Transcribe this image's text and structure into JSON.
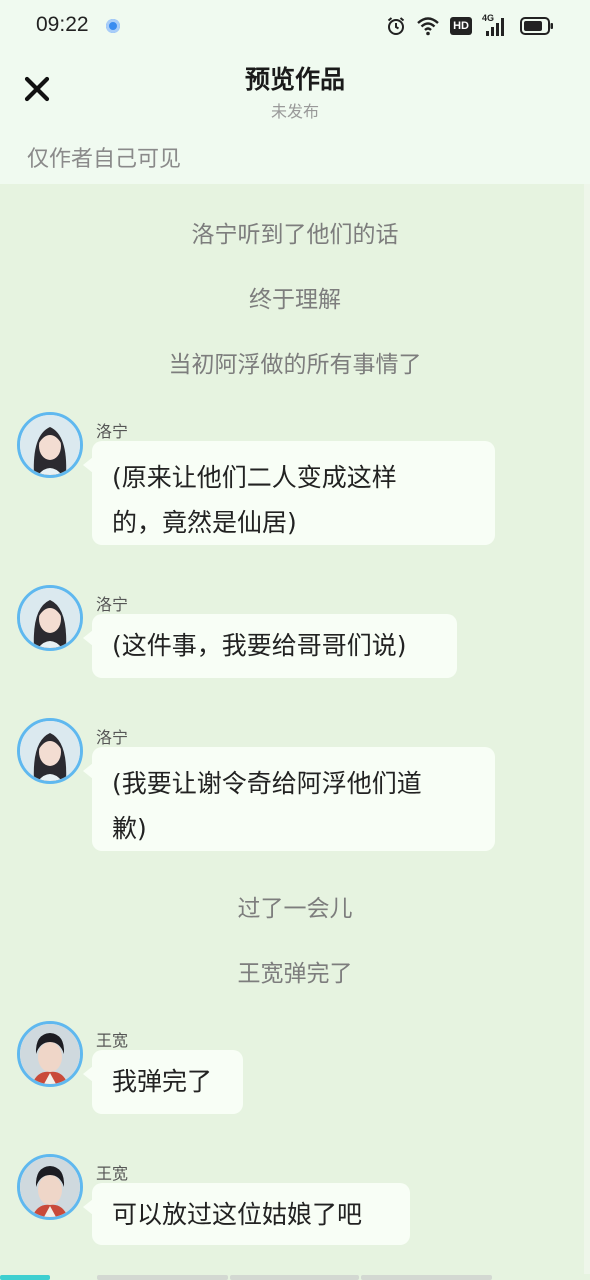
{
  "status_bar": {
    "time": "09:22",
    "icons": [
      "alarm-icon",
      "wifi-icon",
      "hd-icon",
      "4g-signal-icon",
      "battery-icon"
    ],
    "network_label": "4G",
    "hd_label": "HD"
  },
  "header": {
    "title": "预览作品",
    "subtitle": "未发布",
    "visibility": "仅作者自己可见",
    "close_icon": "close-icon"
  },
  "colors": {
    "background": "#e6f3e0",
    "header_bg": "#f0faf0",
    "bubble_bg": "#f8fef6",
    "avatar_ring": "#5fb8ef",
    "progress_active": "#3ecfd0"
  },
  "story": [
    {
      "type": "narration",
      "text": "洛宁听到了他们的话"
    },
    {
      "type": "narration",
      "text": "终于理解"
    },
    {
      "type": "narration",
      "text": "当初阿浮做的所有事情了"
    },
    {
      "type": "message",
      "speaker": "洛宁",
      "lines": [
        "(原来让他们二人变成这样",
        "的，竟然是仙居)"
      ]
    },
    {
      "type": "message",
      "speaker": "洛宁",
      "lines": [
        "(这件事，我要给哥哥们说)"
      ]
    },
    {
      "type": "message",
      "speaker": "洛宁",
      "lines": [
        "(我要让谢令奇给阿浮他们道",
        "歉)"
      ]
    },
    {
      "type": "narration",
      "text": "过了一会儿"
    },
    {
      "type": "narration",
      "text": "王宽弹完了"
    },
    {
      "type": "message",
      "speaker": "王宽",
      "lines": [
        "我弹完了"
      ]
    },
    {
      "type": "message",
      "speaker": "王宽",
      "lines": [
        "可以放过这位姑娘了吧"
      ]
    }
  ]
}
